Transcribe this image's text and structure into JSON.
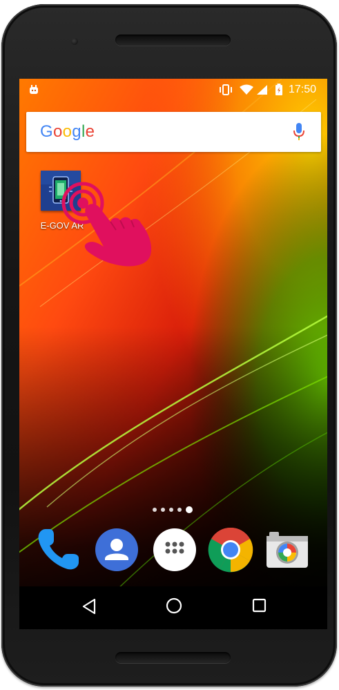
{
  "status_bar": {
    "time": "17:50",
    "icons": [
      "android-notification-icon",
      "vibrate-icon",
      "wifi-icon",
      "cell-signal-icon",
      "battery-charging-icon"
    ]
  },
  "search_widget": {
    "logo_text": "Google",
    "logo_colors": [
      "#4285F4",
      "#EA4335",
      "#FBBC05",
      "#4285F4",
      "#34A853",
      "#EA4335"
    ],
    "mic_icon": "mic-icon"
  },
  "home_apps": [
    {
      "label": "E-GOV AR",
      "icon": "e-gov-ar-app-icon"
    }
  ],
  "tap_hint": {
    "icon": "hand-pointer-icon",
    "color": "#e0105e"
  },
  "page_indicator": {
    "pages": 5,
    "active_page": 5
  },
  "dock": [
    {
      "name": "phone",
      "icon": "phone-icon"
    },
    {
      "name": "contacts",
      "icon": "contacts-icon"
    },
    {
      "name": "app-drawer",
      "icon": "app-drawer-icon"
    },
    {
      "name": "chrome",
      "icon": "chrome-icon"
    },
    {
      "name": "camera",
      "icon": "camera-icon"
    }
  ],
  "nav_bar": [
    "back-icon",
    "home-icon",
    "recents-icon"
  ]
}
